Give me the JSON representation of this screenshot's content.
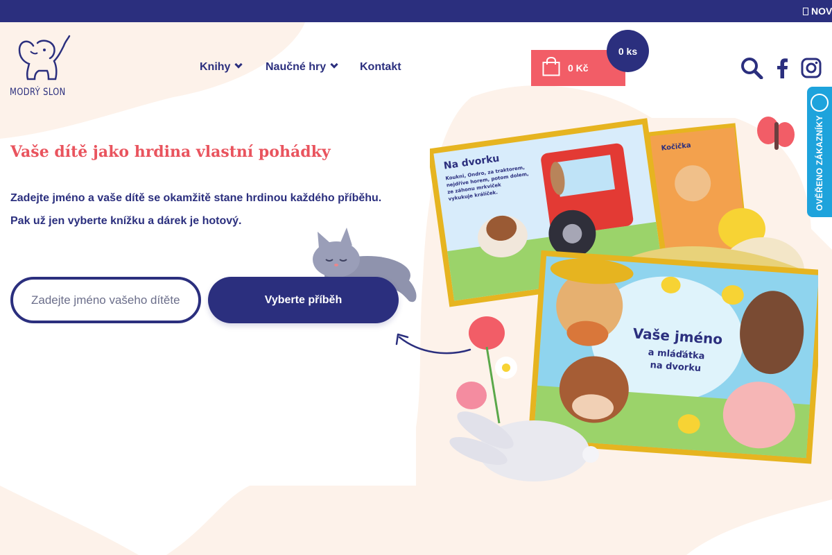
{
  "announcement": {
    "text": "NOV"
  },
  "brand": {
    "name": "MODRÝ SLON"
  },
  "nav": {
    "items": [
      {
        "label": "Knihy",
        "has_dropdown": true
      },
      {
        "label": "Naučné hry",
        "has_dropdown": true
      },
      {
        "label": "Kontakt",
        "has_dropdown": false
      }
    ]
  },
  "cart": {
    "price": "0 Kč",
    "count": "0 ks"
  },
  "header_icons": [
    "search-icon",
    "facebook-icon",
    "instagram-icon"
  ],
  "verified_widget": {
    "label": "OVĚŘENO ZÁKAZNÍKY"
  },
  "hero": {
    "title": "Vaše dítě jako hrdina vlastní pohádky",
    "line1": "Zadejte jméno a vaše dítě se okamžitě stane hrdinou každého příběhu.",
    "line2": "Pak už jen vyberte knížku a dárek je hotový.",
    "input_placeholder": "Zadejte jméno vašeho dítěte",
    "cta_label": "Vyberte příběh"
  },
  "book_back": {
    "heading": "Na dvorku",
    "text": [
      "Koukni, Ondro, za traktorem,",
      "nejdříve horem, potom dolem,",
      "ze záhonu mrkviček",
      "vykukuje králíček."
    ],
    "heading2": "Kočička"
  },
  "book_front": {
    "title_line1": "Vaše jméno",
    "title_line2": "a mláďátka",
    "title_line3": "na dvorku"
  },
  "colors": {
    "navy": "#2b2f7e",
    "coral": "#f25d67",
    "title_red": "#e9545e",
    "verified_blue": "#1ea3dc",
    "blob": "#fdf2ea"
  }
}
